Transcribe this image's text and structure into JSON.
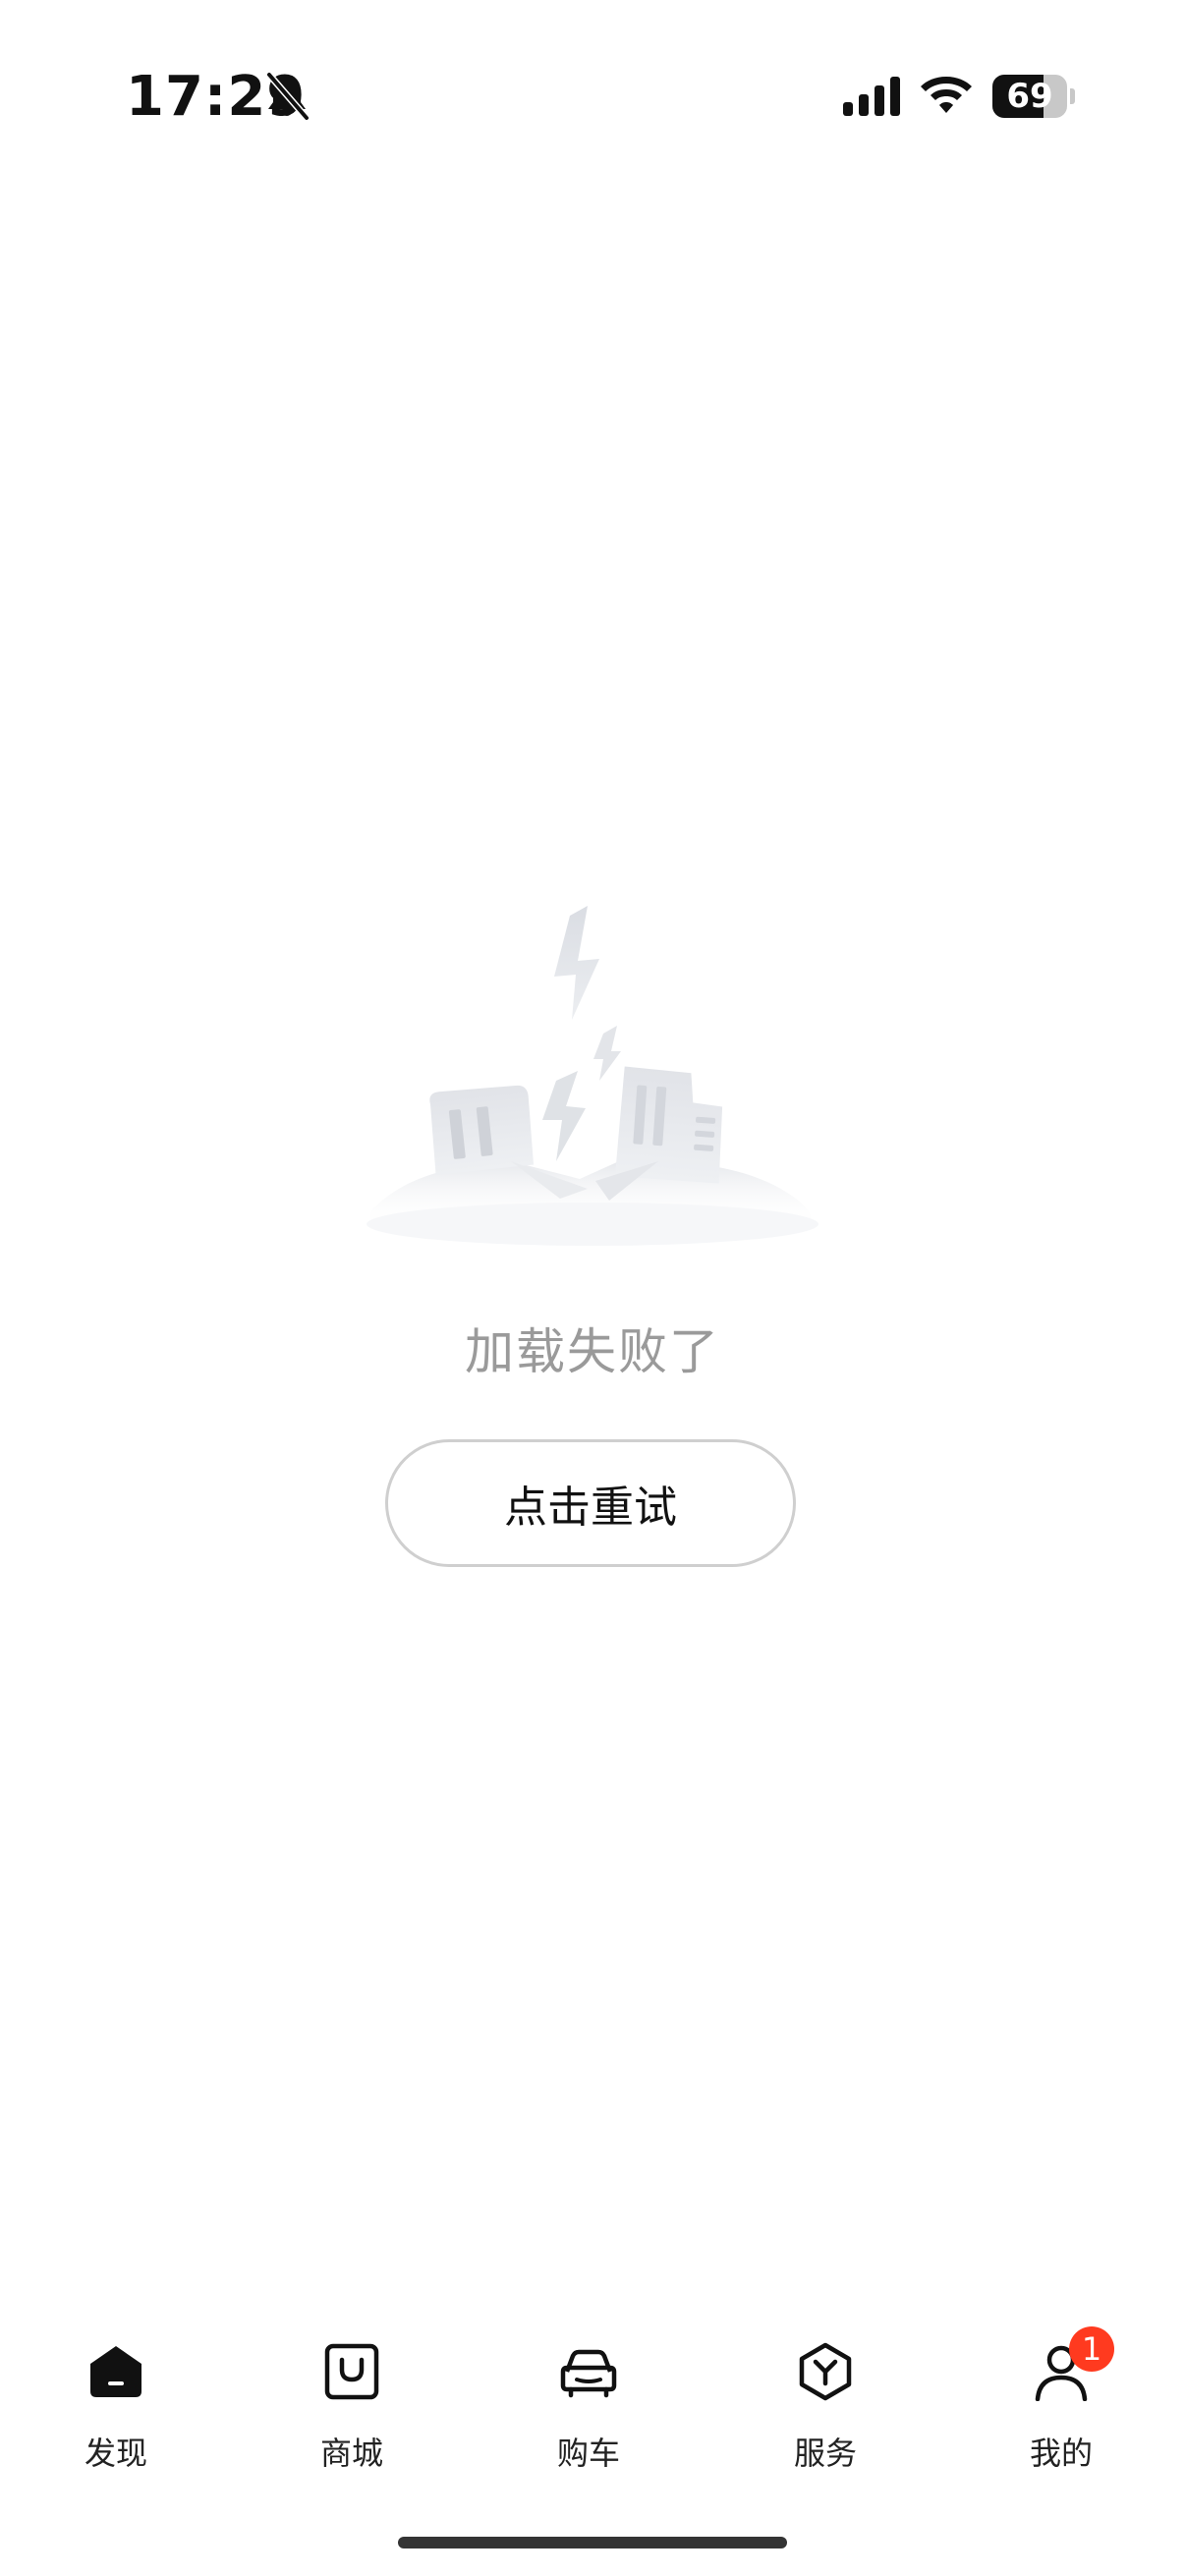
{
  "status_bar": {
    "time": "17:29",
    "battery_level": "69",
    "battery_fraction": 0.69,
    "icons": [
      "bell-slash-icon",
      "cellular-signal-icon",
      "wifi-icon",
      "battery-icon"
    ]
  },
  "error_state": {
    "illustration": "broken-city-lightning-illustration",
    "message": "加载失败了",
    "retry_label": "点击重试"
  },
  "tab_bar": {
    "items": [
      {
        "label": "发现",
        "icon": "home-icon",
        "active": true
      },
      {
        "label": "商城",
        "icon": "shopping-bag-icon",
        "active": false
      },
      {
        "label": "购车",
        "icon": "car-icon",
        "active": false
      },
      {
        "label": "服务",
        "icon": "service-hexagon-icon",
        "active": false
      },
      {
        "label": "我的",
        "icon": "user-profile-icon",
        "active": false,
        "badge": "1"
      }
    ]
  },
  "colors": {
    "background": "#ffffff",
    "text_primary": "#111111",
    "text_muted": "#9a9a9a",
    "badge": "#ff3a1f",
    "button_border": "#cfcfcf"
  }
}
